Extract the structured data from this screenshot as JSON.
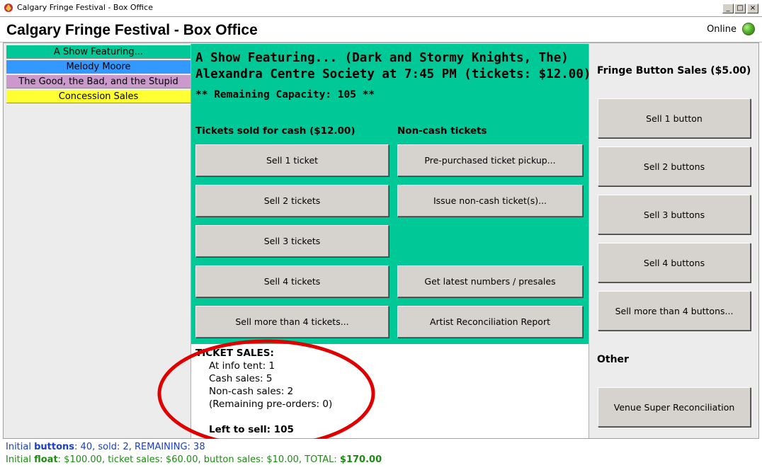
{
  "window": {
    "title": "Calgary Fringe Festival - Box Office",
    "minimize_glyph": "_",
    "maximize_glyph": "□",
    "close_glyph": "×"
  },
  "header": {
    "title": "Calgary Fringe Festival - Box Office",
    "online_label": "Online",
    "online_led_color": "#55b52a"
  },
  "show_list": [
    {
      "label": "A Show Featuring...",
      "color": "#00c896"
    },
    {
      "label": "Melody Moore",
      "color": "#3399ff"
    },
    {
      "label": "The Good, the Bad, and the Stupid",
      "color": "#cc99cc"
    },
    {
      "label": "Concession Sales",
      "color": "#ffff33"
    }
  ],
  "main": {
    "show_line1": "A Show Featuring... (Dark and Stormy Knights, The)",
    "show_line2": "Alexandra Centre Society at 7:45 PM (tickets: $12.00)",
    "capacity": "** Remaining Capacity: 105 **",
    "cash_heading": "Tickets sold for cash ($12.00)",
    "noncash_heading": "Non-cash tickets",
    "cash_buttons": [
      "Sell 1 ticket",
      "Sell 2 tickets",
      "Sell 3 tickets",
      "Sell 4 tickets",
      "Sell more than 4 tickets..."
    ],
    "noncash_buttons": [
      "Pre-purchased ticket pickup...",
      "Issue non-cash ticket(s)...",
      "Get latest numbers / presales",
      "Artist Reconciliation Report"
    ],
    "panel_color": "#00c896"
  },
  "ticket_sales": {
    "heading": "TICKET SALES:",
    "info_tent": "At info tent: 1",
    "cash": "Cash sales: 5",
    "noncash": "Non-cash sales: 2",
    "preorders": "(Remaining pre-orders: 0)",
    "left_to_sell": "Left to sell: 105",
    "annotation_color": "#e00000"
  },
  "right": {
    "button_heading": "Fringe Button Sales ($5.00)",
    "button_buttons": [
      "Sell 1 button",
      "Sell 2 buttons",
      "Sell 3 buttons",
      "Sell 4 buttons",
      "Sell more than 4 buttons..."
    ],
    "other_heading": "Other",
    "other_button": "Venue Super Reconciliation"
  },
  "status": {
    "line1_prefix": "Initial ",
    "line1_bold": "buttons",
    "line1_rest": ": 40, sold: 2, REMAINING: 38",
    "line2_prefix": "Initial ",
    "line2_bold": "float",
    "line2_rest": ": $100.00, ticket sales: $60.00, button sales: $10.00, TOTAL: ",
    "line2_total": "$170.00",
    "blue": "#1a3ec8",
    "green": "#1e8a14"
  }
}
